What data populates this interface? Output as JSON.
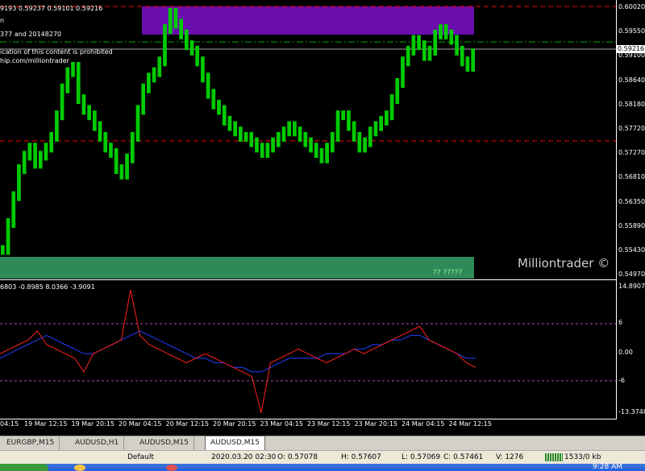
{
  "info": {
    "ohlc": "9193 0.59237 0.59101 0.59216",
    "line2": "n",
    "line3": "377 and 20148270",
    "line4": "ication of this content is prohibited",
    "line5": "hip.com/milliontrader"
  },
  "price_axis": [
    "0.60020",
    "0.59550",
    "0.59100",
    "0.58640",
    "0.58180",
    "0.57720",
    "0.57270",
    "0.56810",
    "0.56350",
    "0.55890",
    "0.55430",
    "0.54970"
  ],
  "current_price": "0.59216",
  "zone_label": "?? ?????",
  "watermark": "Milliontrader ©",
  "indicator": {
    "values": "6803 -0.8985 8.0366 -3.9091",
    "axis": [
      "14.8907",
      "6",
      "0.00",
      "-6",
      "-13.3748"
    ]
  },
  "time_axis": [
    "04:15",
    "19 Mar 12:15",
    "19 Mar 20:15",
    "20 Mar 04:15",
    "20 Mar 12:15",
    "20 Mar 20:15",
    "23 Mar 04:15",
    "23 Mar 12:15",
    "23 Mar 20:15",
    "24 Mar 04:15",
    "24 Mar 12:15"
  ],
  "tabs": [
    "EURGBP,M15",
    "AUDUSD,H1",
    "AUDUSD,M15",
    "AUDUSD,M15"
  ],
  "active_tab": 3,
  "status": {
    "profile": "Default",
    "datetime": "2020.03.20 02:30",
    "open": "O: 0.57078",
    "high": "H: 0.57607",
    "low": "L: 0.57069",
    "close": "C: 0.57461",
    "volume": "V: 1276",
    "traffic": "1533/0 kb"
  },
  "clock": "9:28 AM",
  "colors": {
    "candles": "#00cc00",
    "supply_zone": "#6a0dad",
    "demand_zone": "#2e8b57",
    "red_level": "#ff0000",
    "green_level": "#00aa00",
    "ind_red": "#ff2020",
    "ind_blue": "#2040ff"
  },
  "chart_data": {
    "type": "line",
    "price_series": [
      0.555,
      0.56,
      0.565,
      0.57,
      0.5725,
      0.574,
      0.571,
      0.5725,
      0.574,
      0.576,
      0.58,
      0.585,
      0.588,
      0.589,
      0.583,
      0.581,
      0.58,
      0.578,
      0.576,
      0.574,
      0.573,
      0.57,
      0.569,
      0.572,
      0.576,
      0.581,
      0.585,
      0.587,
      0.588,
      0.59,
      0.596,
      0.599,
      0.597,
      0.595,
      0.593,
      0.592,
      0.59,
      0.587,
      0.584,
      0.582,
      0.581,
      0.579,
      0.578,
      0.577,
      0.576,
      0.576,
      0.575,
      0.574,
      0.573,
      0.574,
      0.575,
      0.576,
      0.577,
      0.578,
      0.577,
      0.576,
      0.575,
      0.574,
      0.573,
      0.572,
      0.574,
      0.576,
      0.58,
      0.58,
      0.578,
      0.576,
      0.574,
      0.575,
      0.577,
      0.578,
      0.579,
      0.58,
      0.583,
      0.586,
      0.59,
      0.592,
      0.594,
      0.593,
      0.591,
      0.592,
      0.595,
      0.596,
      0.595,
      0.594,
      0.592,
      0.59,
      0.589,
      0.5915
    ],
    "ind_red": [
      0,
      1,
      2,
      3,
      5,
      2,
      1,
      0,
      -1,
      -4,
      0,
      1,
      2,
      3,
      14,
      4,
      2,
      1,
      0,
      -1,
      -2,
      -1,
      0,
      -1,
      -2,
      -3,
      -4,
      -5,
      -13,
      -2,
      -1,
      0,
      1,
      0,
      -1,
      -2,
      -1,
      0,
      1,
      0,
      1,
      2,
      3,
      4,
      5,
      6,
      3,
      2,
      1,
      0,
      -2,
      -3
    ],
    "ind_blue": [
      -1,
      0,
      1,
      2,
      3,
      4,
      3,
      2,
      1,
      0,
      0,
      1,
      2,
      3,
      4,
      5,
      4,
      3,
      2,
      1,
      0,
      -1,
      -1,
      -2,
      -2,
      -3,
      -3,
      -4,
      -4,
      -3,
      -2,
      -1,
      -1,
      -1,
      -1,
      0,
      0,
      0,
      1,
      1,
      2,
      2,
      3,
      3,
      4,
      4,
      3,
      2,
      1,
      0,
      -1,
      -1
    ],
    "levels": [
      0.6002,
      0.5955,
      0.59216,
      0.5751
    ],
    "ylim": [
      0.5497,
      0.6002
    ],
    "ind_ylim": [
      -13.3748,
      14.8907
    ]
  }
}
